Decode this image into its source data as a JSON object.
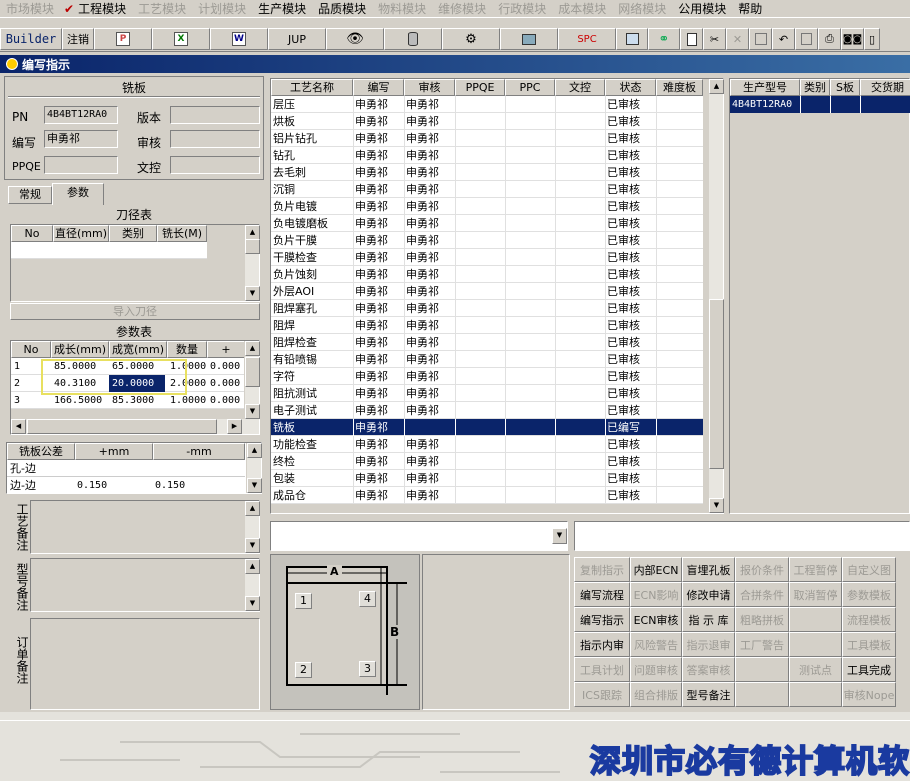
{
  "menu": [
    {
      "label": "市场模块",
      "disabled": true
    },
    {
      "label": "工程模块",
      "disabled": false,
      "checked": true
    },
    {
      "label": "工艺模块",
      "disabled": true
    },
    {
      "label": "计划模块",
      "disabled": true
    },
    {
      "label": "生产模块",
      "disabled": false
    },
    {
      "label": "品质模块",
      "disabled": false
    },
    {
      "label": "物料模块",
      "disabled": true
    },
    {
      "label": "维修模块",
      "disabled": true
    },
    {
      "label": "行政模块",
      "disabled": true
    },
    {
      "label": "成本模块",
      "disabled": true
    },
    {
      "label": "网络模块",
      "disabled": true
    },
    {
      "label": "公用模块",
      "disabled": false
    },
    {
      "label": "帮助",
      "disabled": false
    }
  ],
  "toolbar": {
    "builder": "Builder",
    "logout": "注销",
    "jup": "JUP",
    "spc": "SPC",
    "icons": [
      "ppt-icon",
      "excel-icon",
      "word-icon",
      "jup-icon",
      "eye-icon",
      "database-icon",
      "tools-icon",
      "computer-icon",
      "spc-icon",
      "calendar-icon",
      "link-icon",
      "new-icon",
      "cut-icon",
      "delete-icon",
      "save-icon",
      "undo-icon",
      "copy-icon",
      "print-icon",
      "binoculars-icon",
      "exit-icon"
    ]
  },
  "window": {
    "title": "编写指示"
  },
  "left": {
    "section_title": "铣板",
    "pn_label": "PN",
    "pn_value": "4B4BT12RA0",
    "version_label": "版本",
    "writer_label": "编写",
    "writer_value": "申勇祁",
    "review_label": "审核",
    "ppqe_label": "PPQE",
    "doc_label": "文控",
    "tabs": [
      "常规",
      "参数"
    ],
    "tool_table": {
      "title": "刀径表",
      "headers": [
        "No",
        "直径(mm)",
        "类别",
        "铣长(M)"
      ]
    },
    "import_button": "导入刀径",
    "param_table": {
      "title": "参数表",
      "headers": [
        "No",
        "成长(mm)",
        "成宽(mm)",
        "数量",
        "+"
      ],
      "rows": [
        [
          "1",
          "85.0000",
          "65.0000",
          "1.0000",
          "0.000"
        ],
        [
          "2",
          "40.3100",
          "20.0000",
          "2.0000",
          "0.000"
        ],
        [
          "3",
          "166.5000",
          "85.3000",
          "1.0000",
          "0.000"
        ]
      ]
    },
    "tolerance": {
      "headers": [
        "铣板公差",
        "+mm",
        "-mm"
      ],
      "rows": [
        [
          "孔-边",
          "",
          ""
        ],
        [
          "边-边",
          "0.150",
          "0.150"
        ]
      ]
    },
    "notes": [
      "工艺备注",
      "型号备注",
      "订单备注"
    ]
  },
  "process": {
    "headers": [
      "工艺名称",
      "编写",
      "审核",
      "PPQE",
      "PPC",
      "文控",
      "状态",
      "难度板"
    ],
    "rows": [
      [
        "层压",
        "申勇祁",
        "申勇祁",
        "",
        "",
        "",
        "已审核",
        ""
      ],
      [
        "烘板",
        "申勇祁",
        "申勇祁",
        "",
        "",
        "",
        "已审核",
        ""
      ],
      [
        "铝片钻孔",
        "申勇祁",
        "申勇祁",
        "",
        "",
        "",
        "已审核",
        ""
      ],
      [
        "钻孔",
        "申勇祁",
        "申勇祁",
        "",
        "",
        "",
        "已审核",
        ""
      ],
      [
        "去毛刺",
        "申勇祁",
        "申勇祁",
        "",
        "",
        "",
        "已审核",
        ""
      ],
      [
        "沉铜",
        "申勇祁",
        "申勇祁",
        "",
        "",
        "",
        "已审核",
        ""
      ],
      [
        "负片电镀",
        "申勇祁",
        "申勇祁",
        "",
        "",
        "",
        "已审核",
        ""
      ],
      [
        "负电镀磨板",
        "申勇祁",
        "申勇祁",
        "",
        "",
        "",
        "已审核",
        ""
      ],
      [
        "负片干膜",
        "申勇祁",
        "申勇祁",
        "",
        "",
        "",
        "已审核",
        ""
      ],
      [
        "干膜检查",
        "申勇祁",
        "申勇祁",
        "",
        "",
        "",
        "已审核",
        ""
      ],
      [
        "负片蚀刻",
        "申勇祁",
        "申勇祁",
        "",
        "",
        "",
        "已审核",
        ""
      ],
      [
        "外层AOI",
        "申勇祁",
        "申勇祁",
        "",
        "",
        "",
        "已审核",
        ""
      ],
      [
        "阻焊塞孔",
        "申勇祁",
        "申勇祁",
        "",
        "",
        "",
        "已审核",
        ""
      ],
      [
        "阻焊",
        "申勇祁",
        "申勇祁",
        "",
        "",
        "",
        "已审核",
        ""
      ],
      [
        "阻焊检查",
        "申勇祁",
        "申勇祁",
        "",
        "",
        "",
        "已审核",
        ""
      ],
      [
        "有铅喷锡",
        "申勇祁",
        "申勇祁",
        "",
        "",
        "",
        "已审核",
        ""
      ],
      [
        "字符",
        "申勇祁",
        "申勇祁",
        "",
        "",
        "",
        "已审核",
        ""
      ],
      [
        "阻抗测试",
        "申勇祁",
        "申勇祁",
        "",
        "",
        "",
        "已审核",
        ""
      ],
      [
        "电子测试",
        "申勇祁",
        "申勇祁",
        "",
        "",
        "",
        "已审核",
        ""
      ],
      [
        "铣板",
        "申勇祁",
        "",
        "",
        "",
        "",
        "已编写",
        ""
      ],
      [
        "功能检查",
        "申勇祁",
        "申勇祁",
        "",
        "",
        "",
        "已审核",
        ""
      ],
      [
        "终检",
        "申勇祁",
        "申勇祁",
        "",
        "",
        "",
        "已审核",
        ""
      ],
      [
        "包装",
        "申勇祁",
        "申勇祁",
        "",
        "",
        "",
        "已审核",
        ""
      ],
      [
        "成品仓",
        "申勇祁",
        "申勇祁",
        "",
        "",
        "",
        "已审核",
        ""
      ]
    ],
    "selected_index": 19
  },
  "production": {
    "headers": [
      "生产型号",
      "类别",
      "S板",
      "交货期"
    ],
    "rows": [
      [
        "4B4BT12RA0",
        "",
        "",
        ""
      ]
    ]
  },
  "diagram": {
    "label_a": "A",
    "label_b": "B",
    "corners": [
      "1",
      "4",
      "2",
      "3"
    ]
  },
  "buttons": [
    [
      {
        "label": "复制指示",
        "enabled": false
      },
      {
        "label": "内部ECN",
        "enabled": true
      },
      {
        "label": "盲埋孔板",
        "enabled": true
      },
      {
        "label": "报价条件",
        "enabled": false
      },
      {
        "label": "工程暂停",
        "enabled": false
      },
      {
        "label": "自定义图",
        "enabled": false
      }
    ],
    [
      {
        "label": "编写流程",
        "enabled": true
      },
      {
        "label": "ECN影响",
        "enabled": false
      },
      {
        "label": "修改申请",
        "enabled": true
      },
      {
        "label": "合拼条件",
        "enabled": false
      },
      {
        "label": "取消暂停",
        "enabled": false
      },
      {
        "label": "参数模板",
        "enabled": false
      }
    ],
    [
      {
        "label": "编写指示",
        "enabled": true
      },
      {
        "label": "ECN审核",
        "enabled": true
      },
      {
        "label": "指 示 库",
        "enabled": true
      },
      {
        "label": "粗略拼板",
        "enabled": false
      },
      {
        "label": "",
        "enabled": false
      },
      {
        "label": "流程模板",
        "enabled": false
      }
    ],
    [
      {
        "label": "指示内审",
        "enabled": true
      },
      {
        "label": "风险警告",
        "enabled": false
      },
      {
        "label": "指示退审",
        "enabled": false
      },
      {
        "label": "工厂警告",
        "enabled": false
      },
      {
        "label": "",
        "enabled": false
      },
      {
        "label": "工具模板",
        "enabled": false
      }
    ],
    [
      {
        "label": "工具计划",
        "enabled": false
      },
      {
        "label": "问题审核",
        "enabled": false
      },
      {
        "label": "答案审核",
        "enabled": false
      },
      {
        "label": "",
        "enabled": false
      },
      {
        "label": "测试点",
        "enabled": false
      },
      {
        "label": "工具完成",
        "enabled": true
      }
    ],
    [
      {
        "label": "ICS跟踪",
        "enabled": false
      },
      {
        "label": "组合排版",
        "enabled": false
      },
      {
        "label": "型号备注",
        "enabled": true
      },
      {
        "label": "",
        "enabled": false
      },
      {
        "label": "",
        "enabled": false
      },
      {
        "label": "审核Nope",
        "enabled": false
      }
    ]
  ],
  "footer": {
    "company": "深圳市必有德计算机软"
  },
  "colors": {
    "selection": "#0a246a",
    "title_start": "#0a246a",
    "highlight_box": "#e8e060",
    "footer_text": "#1a3aa0"
  }
}
